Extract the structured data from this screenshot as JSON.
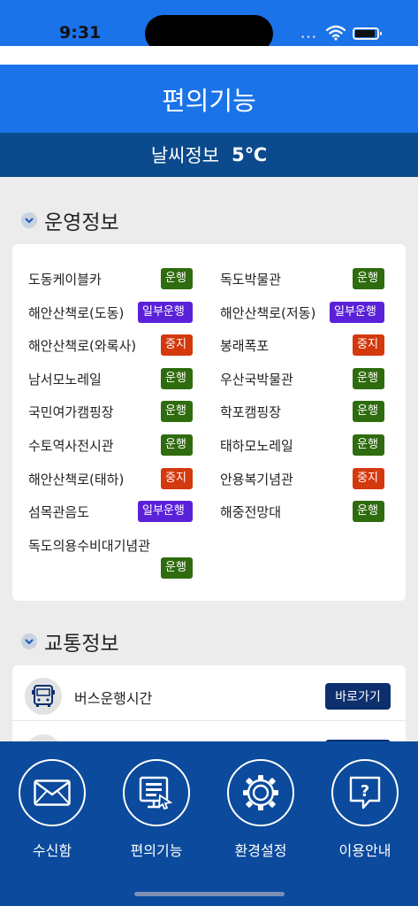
{
  "status": {
    "time": "9:31",
    "signal": "•••"
  },
  "header": {
    "title": "편의기능"
  },
  "weather": {
    "label": "날씨정보",
    "temp": "5℃"
  },
  "operations": {
    "title": "운영정보",
    "items": [
      {
        "name": "도동케이블카",
        "status": "운행",
        "kind": "run"
      },
      {
        "name": "독도박물관",
        "status": "운행",
        "kind": "run"
      },
      {
        "name": "해안산책로(도동)",
        "status": "일부운행",
        "kind": "partial"
      },
      {
        "name": "해안산책로(저동)",
        "status": "일부운행",
        "kind": "partial"
      },
      {
        "name": "해안산책로(와록사)",
        "status": "중지",
        "kind": "stop"
      },
      {
        "name": "봉래폭포",
        "status": "중지",
        "kind": "stop"
      },
      {
        "name": "남서모노레일",
        "status": "운행",
        "kind": "run"
      },
      {
        "name": "우산국박물관",
        "status": "운행",
        "kind": "run"
      },
      {
        "name": "국민여가캠핑장",
        "status": "운행",
        "kind": "run"
      },
      {
        "name": "학포캠핑장",
        "status": "운행",
        "kind": "run"
      },
      {
        "name": "수토역사전시관",
        "status": "운행",
        "kind": "run"
      },
      {
        "name": "태하모노레일",
        "status": "운행",
        "kind": "run"
      },
      {
        "name": "해안산책로(태하)",
        "status": "중지",
        "kind": "stop"
      },
      {
        "name": "안용복기념관",
        "status": "중지",
        "kind": "stop"
      },
      {
        "name": "섬목관음도",
        "status": "일부운행",
        "kind": "partial"
      },
      {
        "name": "해중전망대",
        "status": "운행",
        "kind": "run"
      },
      {
        "name": "독도의용수비대기념관",
        "status": "운행",
        "kind": "run"
      }
    ]
  },
  "traffic": {
    "title": "교통정보",
    "rows": [
      {
        "label": "버스운행시간",
        "button": "바로가기"
      }
    ]
  },
  "nav": {
    "items": [
      {
        "label": "수신함",
        "icon": "envelope-icon"
      },
      {
        "label": "편의기능",
        "icon": "monitor-icon"
      },
      {
        "label": "환경설정",
        "icon": "gear-icon"
      },
      {
        "label": "이용안내",
        "icon": "help-bubble-icon"
      }
    ]
  },
  "colors": {
    "primary": "#1a73e8",
    "dark": "#0b4a8c",
    "run": "#2f6b0f",
    "partial": "#5a22d8",
    "stop": "#d4380d",
    "nav": "#0b4a9c"
  }
}
